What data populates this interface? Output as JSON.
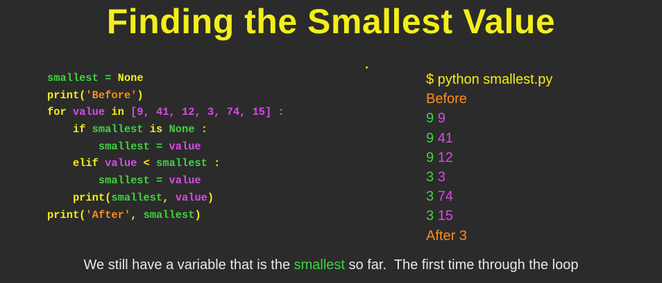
{
  "title": "Finding the Smallest Value",
  "code": {
    "line1": {
      "a": "smallest = ",
      "b": "None"
    },
    "line2": {
      "a": "print(",
      "b": "'Before'",
      "c": ")"
    },
    "line3": {
      "a": "for ",
      "b": "value",
      "c": " in ",
      "d": "[9, 41, 12, 3, 74, 15]",
      "e": " :"
    },
    "line4": {
      "a": "    if ",
      "b": "smallest",
      "c": " is ",
      "d": "None",
      "e": " :"
    },
    "line5": {
      "a": "        smallest = ",
      "b": "value"
    },
    "line6": {
      "a": "    elif ",
      "b": "value",
      "c": " < ",
      "d": "smallest",
      "e": " :"
    },
    "line7": {
      "a": "        smallest = ",
      "b": "value"
    },
    "line8": {
      "a": "    print(",
      "b": "smallest",
      "c": ", ",
      "d": "value",
      "e": ")"
    },
    "line9": {
      "a": "print(",
      "b": "'After'",
      "c": ", ",
      "d": "smallest",
      "e": ")"
    }
  },
  "output": {
    "command": "$ python smallest.py",
    "before": "Before",
    "rows": [
      {
        "a": "9",
        "b": "9"
      },
      {
        "a": "9",
        "b": "41"
      },
      {
        "a": "9",
        "b": "12"
      },
      {
        "a": "3",
        "b": "3"
      },
      {
        "a": "3",
        "b": "74"
      },
      {
        "a": "3",
        "b": "15"
      }
    ],
    "after": "After 3"
  },
  "caption": {
    "pre": "We still have a variable that is the ",
    "highlight": "smallest",
    "post": " so far.  The first time through the loop"
  },
  "colors": {
    "background": "#2b2b2b",
    "title": "#f3ee1a",
    "green": "#3fd23f",
    "purple": "#d94ae8",
    "orange": "#ff8c1a"
  }
}
